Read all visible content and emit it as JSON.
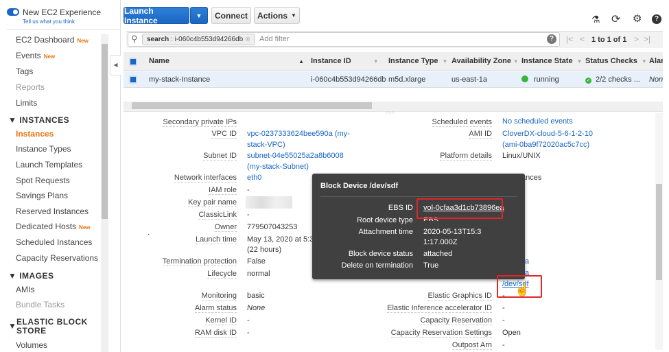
{
  "sidebar": {
    "new_experience": "New EC2 Experience",
    "feedback_link": "Tell us what you think",
    "new_badge": "New",
    "items": [
      {
        "label": "EC2 Dashboard",
        "badge": "New"
      },
      {
        "label": "Events",
        "badge": "New"
      },
      {
        "label": "Tags"
      },
      {
        "label": "Reports"
      },
      {
        "label": "Limits"
      }
    ],
    "sections": [
      {
        "title": "INSTANCES",
        "items": [
          "Instances",
          "Instance Types",
          "Launch Templates",
          "Spot Requests",
          "Savings Plans",
          "Reserved Instances",
          "Dedicated Hosts",
          "Scheduled Instances",
          "Capacity Reservations"
        ]
      },
      {
        "title": "IMAGES",
        "items": [
          "AMIs",
          "Bundle Tasks"
        ]
      },
      {
        "title": "ELASTIC BLOCK STORE",
        "items": [
          "Volumes"
        ]
      }
    ]
  },
  "toolbar": {
    "launch": "Launch Instance",
    "connect": "Connect",
    "actions": "Actions"
  },
  "filter": {
    "chip_key": "search",
    "chip_value": "i-060c4b553d94266db",
    "placeholder": "Add filter",
    "pagination": "1 to 1 of 1"
  },
  "table": {
    "columns": [
      "Name",
      "Instance ID",
      "Instance Type",
      "Availability Zone",
      "Instance State",
      "Status Checks",
      "Alar"
    ],
    "row": {
      "name": "my-stack-Instance",
      "id": "i-060c4b553d94266db",
      "type": "m5d.xlarge",
      "az": "us-east-1a",
      "state": "running",
      "checks": "2/2 checks ...",
      "alarm": "None"
    }
  },
  "details": {
    "left": [
      {
        "label": "Secondary private IPs",
        "value": ""
      },
      {
        "label": "VPC ID",
        "value": "vpc-0237333624bee590a (my-stack-VPC)"
      },
      {
        "label": "Subnet ID",
        "value": "subnet-04e55025a2a8b6008 (my-stack-Subnet)"
      },
      {
        "label": "Network interfaces",
        "value": "eth0"
      },
      {
        "label": "IAM role",
        "value": "-"
      },
      {
        "label": "Key pair name",
        "value": ""
      },
      {
        "label": "ClassicLink",
        "value": "-"
      },
      {
        "label": "Owner",
        "value": "779507043253"
      },
      {
        "label": "Launch time",
        "value": "May 13, 2020 at 5:31:",
        "value2": "(22 hours)"
      },
      {
        "label": "Termination protection",
        "value": "False"
      },
      {
        "label": "Lifecycle",
        "value": "normal"
      },
      {
        "label": "Monitoring",
        "value": "basic"
      },
      {
        "label": "Alarm status",
        "value": "None"
      },
      {
        "label": "Kernel ID",
        "value": "-"
      },
      {
        "label": "RAM disk ID",
        "value": "-"
      }
    ],
    "right": [
      {
        "label": "Scheduled events",
        "value": "No scheduled events"
      },
      {
        "label": "AMI ID",
        "value": "CloverDX-cloud-5-6-1-2-10 (ami-0ba9f72020ac5c7cc)"
      },
      {
        "label": "Platform details",
        "value": "Linux/UNIX"
      },
      {
        "label": "",
        "value": "ances"
      },
      {
        "label": "",
        "value": "a"
      },
      {
        "label": "",
        "value": "a"
      },
      {
        "label": "",
        "value": "/dev/sdf"
      },
      {
        "label": "Elastic Graphics ID",
        "value": "-"
      },
      {
        "label": "Elastic Inference accelerator ID",
        "value": "-"
      },
      {
        "label": "Capacity Reservation",
        "value": "-"
      },
      {
        "label": "Capacity Reservation Settings",
        "value": "Open"
      },
      {
        "label": "Outpost Arn",
        "value": "-"
      }
    ]
  },
  "popup": {
    "title": "Block Device /dev/sdf",
    "rows": [
      {
        "label": "EBS ID",
        "value": "vol-0cfaa3d1cb73896ea"
      },
      {
        "label": "Root device type",
        "value": "EBS"
      },
      {
        "label": "Attachment time",
        "value": "2020-05-13T15:31:17.000Z"
      },
      {
        "label": "Block device status",
        "value": "attached"
      },
      {
        "label": "Delete on termination",
        "value": "True"
      }
    ]
  },
  "colors": {
    "primary": "#1a66c4",
    "accent": "#ec7211",
    "highlight": "#e0262b",
    "running": "#3bb53b"
  }
}
